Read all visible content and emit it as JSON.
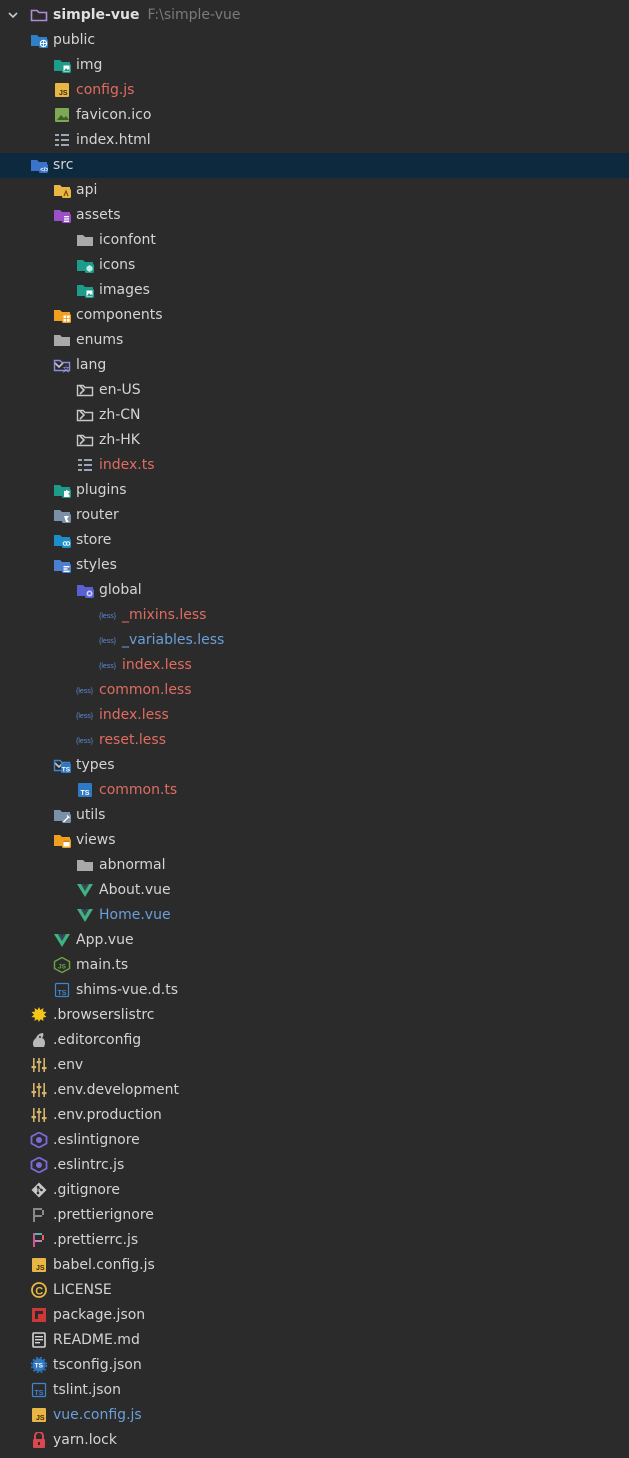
{
  "project": {
    "name": "simple-vue",
    "path": "F:\\simple-vue"
  },
  "colors": {
    "background": "#2b2b2b",
    "selected": "#0d293e",
    "modified": "#e06c60",
    "changed": "#6a9fd8"
  },
  "items": [
    {
      "label": "simple-vue",
      "depth": 0,
      "expander": "expanded",
      "icon": "project-folder-icon",
      "color": "bold",
      "path": "F:\\simple-vue"
    },
    {
      "label": "public",
      "depth": 1,
      "expander": "expanded",
      "icon": "web-folder-icon",
      "color": "default"
    },
    {
      "label": "img",
      "depth": 2,
      "expander": "none",
      "icon": "image-folder-icon",
      "color": "default"
    },
    {
      "label": "config.js",
      "depth": 2,
      "expander": "none",
      "icon": "js-file-icon",
      "color": "red"
    },
    {
      "label": "favicon.ico",
      "depth": 2,
      "expander": "none",
      "icon": "image-file-icon",
      "color": "default"
    },
    {
      "label": "index.html",
      "depth": 2,
      "expander": "none",
      "icon": "html-file-icon",
      "color": "default"
    },
    {
      "label": "src",
      "depth": 1,
      "expander": "expanded",
      "icon": "source-folder-icon",
      "color": "default",
      "selected": true
    },
    {
      "label": "api",
      "depth": 2,
      "expander": "collapsed",
      "icon": "api-folder-icon",
      "color": "default"
    },
    {
      "label": "assets",
      "depth": 2,
      "expander": "expanded",
      "icon": "assets-folder-icon",
      "color": "default"
    },
    {
      "label": "iconfont",
      "depth": 3,
      "expander": "none",
      "icon": "folder-icon",
      "color": "default"
    },
    {
      "label": "icons",
      "depth": 3,
      "expander": "none",
      "icon": "icons-folder-icon",
      "color": "default"
    },
    {
      "label": "images",
      "depth": 3,
      "expander": "none",
      "icon": "image-folder-icon",
      "color": "default"
    },
    {
      "label": "components",
      "depth": 2,
      "expander": "collapsed",
      "icon": "components-folder-icon",
      "color": "default"
    },
    {
      "label": "enums",
      "depth": 2,
      "expander": "none",
      "icon": "folder-icon",
      "color": "default"
    },
    {
      "label": "lang",
      "depth": 2,
      "expander": "expanded",
      "icon": "lang-folder-icon",
      "color": "default"
    },
    {
      "label": "en-US",
      "depth": 3,
      "expander": "collapsed",
      "icon": "outline-folder-icon",
      "color": "default"
    },
    {
      "label": "zh-CN",
      "depth": 3,
      "expander": "collapsed",
      "icon": "outline-folder-icon",
      "color": "default"
    },
    {
      "label": "zh-HK",
      "depth": 3,
      "expander": "collapsed",
      "icon": "outline-folder-icon",
      "color": "default"
    },
    {
      "label": "index.ts",
      "depth": 3,
      "expander": "none",
      "icon": "module-file-icon",
      "color": "red"
    },
    {
      "label": "plugins",
      "depth": 2,
      "expander": "collapsed",
      "icon": "plugins-folder-icon",
      "color": "default"
    },
    {
      "label": "router",
      "depth": 2,
      "expander": "collapsed",
      "icon": "router-folder-icon",
      "color": "default"
    },
    {
      "label": "store",
      "depth": 2,
      "expander": "collapsed",
      "icon": "store-folder-icon",
      "color": "default"
    },
    {
      "label": "styles",
      "depth": 2,
      "expander": "expanded",
      "icon": "styles-folder-icon",
      "color": "default"
    },
    {
      "label": "global",
      "depth": 3,
      "expander": "expanded",
      "icon": "global-folder-icon",
      "color": "default"
    },
    {
      "label": "_mixins.less",
      "depth": 4,
      "expander": "none",
      "icon": "less-file-icon",
      "color": "red",
      "icon_text": "{less}"
    },
    {
      "label": "_variables.less",
      "depth": 4,
      "expander": "none",
      "icon": "less-file-icon",
      "color": "blue",
      "icon_text": "{less}"
    },
    {
      "label": "index.less",
      "depth": 4,
      "expander": "none",
      "icon": "less-file-icon",
      "color": "red",
      "icon_text": "{less}"
    },
    {
      "label": "common.less",
      "depth": 3,
      "expander": "none",
      "icon": "less-file-icon",
      "color": "red",
      "icon_text": "{less}"
    },
    {
      "label": "index.less",
      "depth": 3,
      "expander": "none",
      "icon": "less-file-icon",
      "color": "red",
      "icon_text": "{less}"
    },
    {
      "label": "reset.less",
      "depth": 3,
      "expander": "none",
      "icon": "less-file-icon",
      "color": "red",
      "icon_text": "{less}"
    },
    {
      "label": "types",
      "depth": 2,
      "expander": "expanded",
      "icon": "types-folder-icon",
      "color": "default",
      "icon_text": "TS"
    },
    {
      "label": "common.ts",
      "depth": 3,
      "expander": "none",
      "icon": "ts-filled-file-icon",
      "color": "red",
      "icon_text": "TS"
    },
    {
      "label": "utils",
      "depth": 2,
      "expander": "none",
      "icon": "utils-folder-icon",
      "color": "default"
    },
    {
      "label": "views",
      "depth": 2,
      "expander": "expanded",
      "icon": "views-folder-icon",
      "color": "default"
    },
    {
      "label": "abnormal",
      "depth": 3,
      "expander": "none",
      "icon": "folder-icon",
      "color": "default"
    },
    {
      "label": "About.vue",
      "depth": 3,
      "expander": "none",
      "icon": "vue-file-icon",
      "color": "default"
    },
    {
      "label": "Home.vue",
      "depth": 3,
      "expander": "none",
      "icon": "vue-file-icon",
      "color": "blue"
    },
    {
      "label": "App.vue",
      "depth": 2,
      "expander": "none",
      "icon": "vue-file-icon",
      "color": "default"
    },
    {
      "label": "main.ts",
      "depth": 2,
      "expander": "none",
      "icon": "node-js-file-icon",
      "color": "default",
      "icon_text": "JS"
    },
    {
      "label": "shims-vue.d.ts",
      "depth": 2,
      "expander": "none",
      "icon": "ts-outline-file-icon",
      "color": "default",
      "icon_text": "TS"
    },
    {
      "label": ".browserslistrc",
      "depth": 1,
      "expander": "none",
      "icon": "browserslist-file-icon",
      "color": "default"
    },
    {
      "label": ".editorconfig",
      "depth": 1,
      "expander": "none",
      "icon": "editorconfig-file-icon",
      "color": "default"
    },
    {
      "label": ".env",
      "depth": 1,
      "expander": "none",
      "icon": "env-file-icon",
      "color": "default"
    },
    {
      "label": ".env.development",
      "depth": 1,
      "expander": "none",
      "icon": "env-file-icon",
      "color": "default"
    },
    {
      "label": ".env.production",
      "depth": 1,
      "expander": "none",
      "icon": "env-file-icon",
      "color": "default"
    },
    {
      "label": ".eslintignore",
      "depth": 1,
      "expander": "none",
      "icon": "eslint-file-icon",
      "color": "default"
    },
    {
      "label": ".eslintrc.js",
      "depth": 1,
      "expander": "none",
      "icon": "eslint-file-icon",
      "color": "default"
    },
    {
      "label": ".gitignore",
      "depth": 1,
      "expander": "none",
      "icon": "git-file-icon",
      "color": "default"
    },
    {
      "label": ".prettierignore",
      "depth": 1,
      "expander": "none",
      "icon": "prettier-ignore-file-icon",
      "color": "default"
    },
    {
      "label": ".prettierrc.js",
      "depth": 1,
      "expander": "none",
      "icon": "prettier-file-icon",
      "color": "default"
    },
    {
      "label": "babel.config.js",
      "depth": 1,
      "expander": "none",
      "icon": "js-file-icon",
      "color": "default"
    },
    {
      "label": "LICENSE",
      "depth": 1,
      "expander": "none",
      "icon": "license-file-icon",
      "color": "default",
      "icon_text": "C"
    },
    {
      "label": "package.json",
      "depth": 1,
      "expander": "none",
      "icon": "npm-file-icon",
      "color": "default"
    },
    {
      "label": "README.md",
      "depth": 1,
      "expander": "none",
      "icon": "readme-file-icon",
      "color": "default"
    },
    {
      "label": "tsconfig.json",
      "depth": 1,
      "expander": "none",
      "icon": "tsconfig-file-icon",
      "color": "default",
      "icon_text": "TS"
    },
    {
      "label": "tslint.json",
      "depth": 1,
      "expander": "none",
      "icon": "ts-outline-file-icon",
      "color": "default",
      "icon_text": "TS"
    },
    {
      "label": "vue.config.js",
      "depth": 1,
      "expander": "none",
      "icon": "js-file-icon",
      "color": "blue"
    },
    {
      "label": "yarn.lock",
      "depth": 1,
      "expander": "none",
      "icon": "lock-file-icon",
      "color": "default"
    }
  ]
}
